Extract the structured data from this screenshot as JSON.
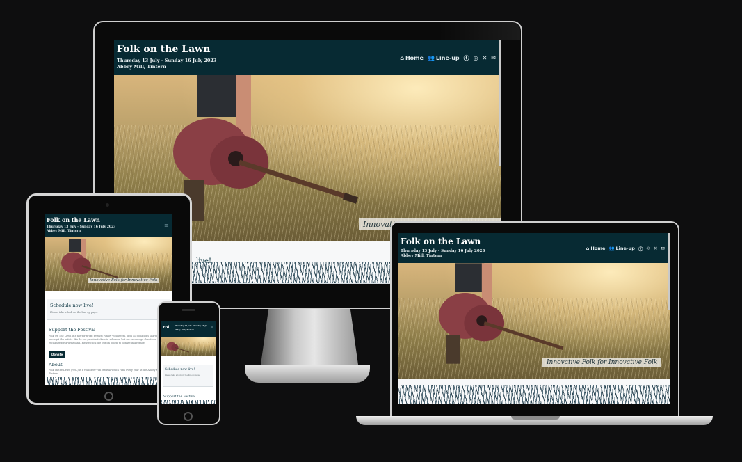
{
  "site": {
    "title": "Folk on the Lawn",
    "title_short": "Fol...",
    "dates": "Thursday 13 July - Sunday 16 July 2023",
    "venue": "Abbey Mill, Tintern",
    "tagline": "Innovative Folk for Innovative Folk",
    "tagline_partial": "Innovative Folk for Innovative Folk",
    "nav": {
      "home": "Home",
      "lineup": "Line-up",
      "icons": [
        "home-icon",
        "users-icon",
        "facebook-icon",
        "instagram-icon",
        "x-icon",
        "mail-icon"
      ]
    },
    "schedule_heading": "Schedule now live!",
    "schedule_heading_partial": "live!",
    "schedule_text": "Please take a look on the line-up page.",
    "support_heading": "Support the Festival",
    "support_text": "Folk On The Lawn is a not-for-profit festival run by volunteers, with all donations shared amongst the artists. We do not provide tickets in advance, but we encourage donations in exchange for a wristband. Please click the button below to donate in advance!",
    "donate_label": "Donate",
    "about_heading": "About",
    "about_text": "Folk on the Lawn (FotL) is a volunteer-run festival which runs every year at the Abbey Mill, Tintern."
  },
  "colors": {
    "background": "#0e0e0f",
    "header": "#072a33",
    "accent_text": "#0a3440"
  }
}
